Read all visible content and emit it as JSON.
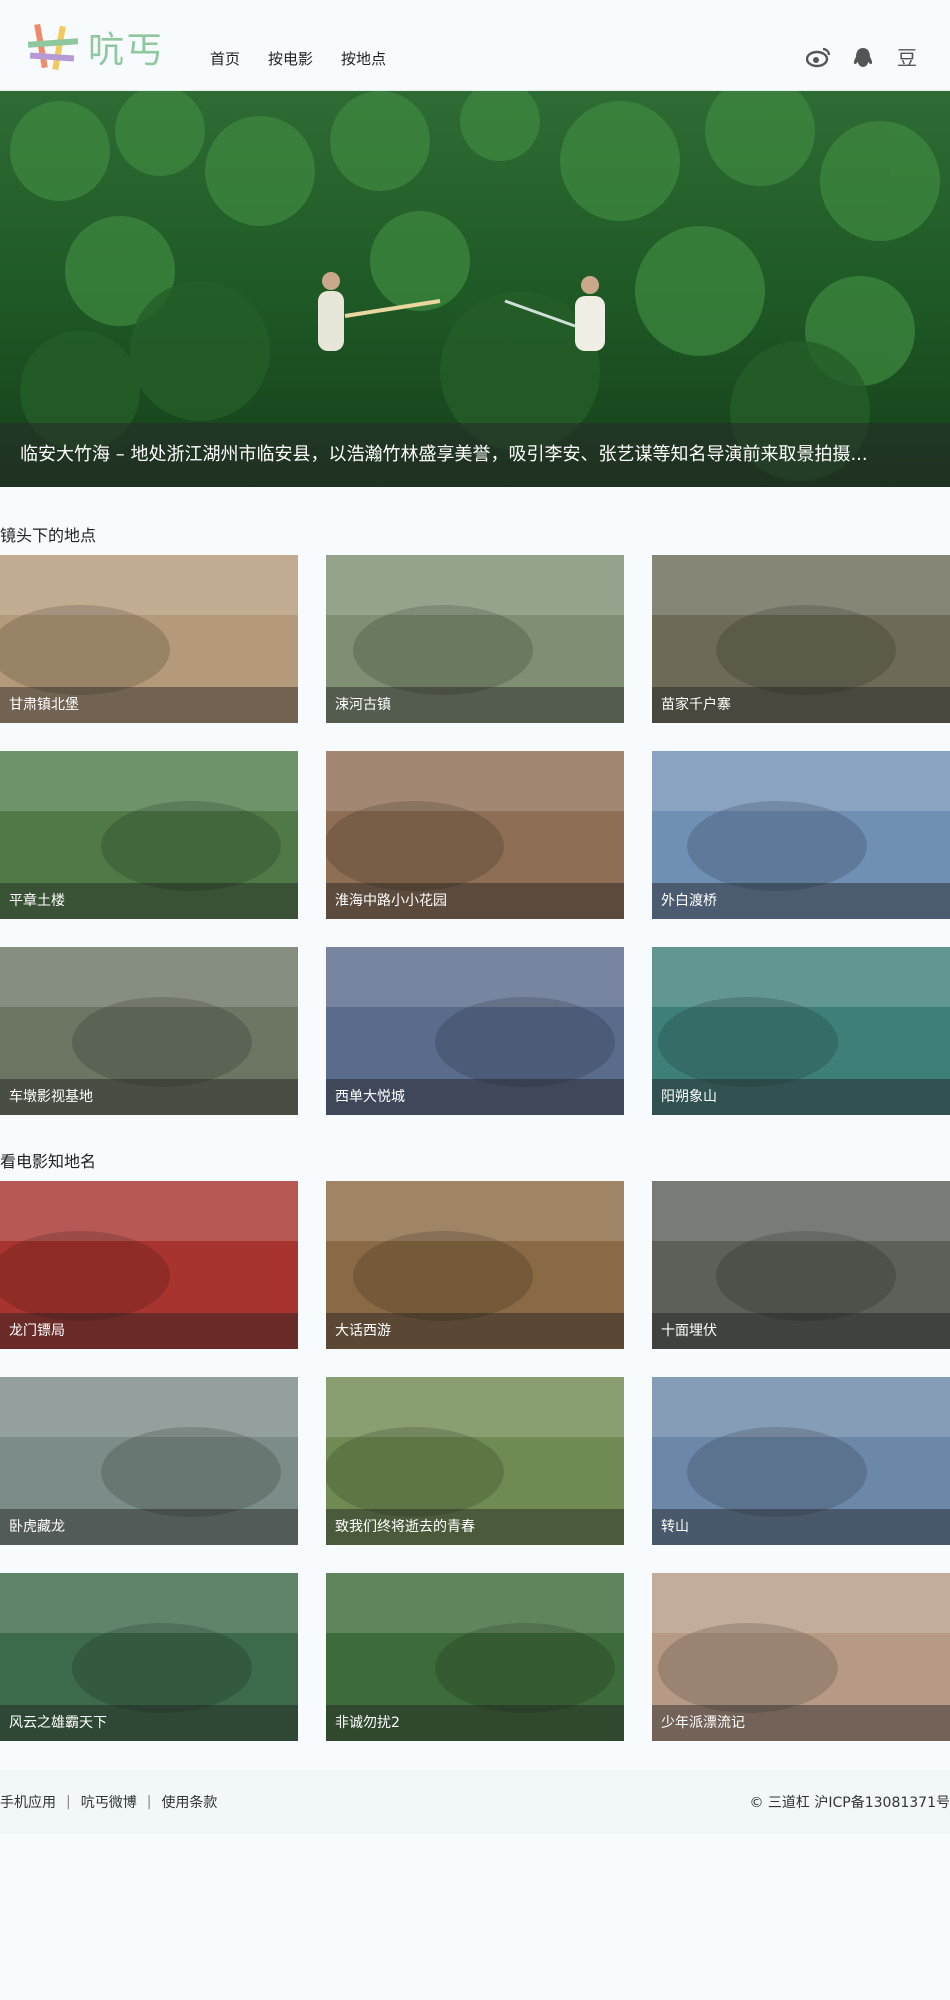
{
  "header": {
    "logo_text": "吭丐",
    "nav": [
      {
        "label": "首页"
      },
      {
        "label": "按电影"
      },
      {
        "label": "按地点"
      }
    ],
    "social": [
      {
        "icon": "weibo-icon",
        "glyph": "◎"
      },
      {
        "icon": "qq-icon",
        "glyph": "▲"
      },
      {
        "icon": "douban-icon",
        "glyph": "豆"
      }
    ]
  },
  "hero": {
    "caption": "临安大竹海 – 地处浙江湖州市临安县，以浩瀚竹林盛享美誉，吸引李安、张艺谋等知名导演前来取景拍摄..."
  },
  "locations_section": {
    "title": "镜头下的地点",
    "items": [
      {
        "label": "甘肃镇北堡",
        "color": "#b49a7a"
      },
      {
        "label": "涑河古镇",
        "color": "#7f8f73"
      },
      {
        "label": "苗家千户寨",
        "color": "#6d6b58"
      },
      {
        "label": "平章土楼",
        "color": "#4f7a48"
      },
      {
        "label": "淮海中路小小花园",
        "color": "#8e6e54"
      },
      {
        "label": "外白渡桥",
        "color": "#6f8fb4"
      },
      {
        "label": "车墩影视基地",
        "color": "#6c7663"
      },
      {
        "label": "西单大悦城",
        "color": "#5a6b8c"
      },
      {
        "label": "阳朔象山",
        "color": "#3f7f7a"
      }
    ]
  },
  "films_section": {
    "title": "看电影知地名",
    "items": [
      {
        "label": "龙门镖局",
        "color": "#a8342f"
      },
      {
        "label": "大话西游",
        "color": "#8a6a45"
      },
      {
        "label": "十面埋伏",
        "color": "#5c6058"
      },
      {
        "label": "卧虎藏龙",
        "color": "#7c8c88"
      },
      {
        "label": "致我们终将逝去的青春",
        "color": "#6f8a52"
      },
      {
        "label": "转山",
        "color": "#6c88a8"
      },
      {
        "label": "风云之雄霸天下",
        "color": "#3d6a4a"
      },
      {
        "label": "非诚勿扰2",
        "color": "#3e6b3a"
      },
      {
        "label": "少年派漂流记",
        "color": "#b79a86"
      }
    ]
  },
  "footer": {
    "links": [
      {
        "label": "手机应用"
      },
      {
        "label": "吭丐微博"
      },
      {
        "label": "使用条款"
      }
    ],
    "separator": "|",
    "copyright": "© 三道杠 沪ICP备13081371号"
  }
}
